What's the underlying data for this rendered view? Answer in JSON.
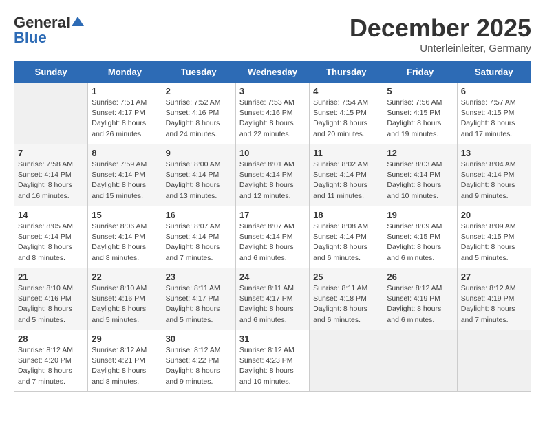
{
  "logo": {
    "general": "General",
    "blue": "Blue"
  },
  "header": {
    "month": "December 2025",
    "location": "Unterleinleiter, Germany"
  },
  "days_of_week": [
    "Sunday",
    "Monday",
    "Tuesday",
    "Wednesday",
    "Thursday",
    "Friday",
    "Saturday"
  ],
  "weeks": [
    [
      {
        "day": "",
        "info": ""
      },
      {
        "day": "1",
        "info": "Sunrise: 7:51 AM\nSunset: 4:17 PM\nDaylight: 8 hours\nand 26 minutes."
      },
      {
        "day": "2",
        "info": "Sunrise: 7:52 AM\nSunset: 4:16 PM\nDaylight: 8 hours\nand 24 minutes."
      },
      {
        "day": "3",
        "info": "Sunrise: 7:53 AM\nSunset: 4:16 PM\nDaylight: 8 hours\nand 22 minutes."
      },
      {
        "day": "4",
        "info": "Sunrise: 7:54 AM\nSunset: 4:15 PM\nDaylight: 8 hours\nand 20 minutes."
      },
      {
        "day": "5",
        "info": "Sunrise: 7:56 AM\nSunset: 4:15 PM\nDaylight: 8 hours\nand 19 minutes."
      },
      {
        "day": "6",
        "info": "Sunrise: 7:57 AM\nSunset: 4:15 PM\nDaylight: 8 hours\nand 17 minutes."
      }
    ],
    [
      {
        "day": "7",
        "info": "Sunrise: 7:58 AM\nSunset: 4:14 PM\nDaylight: 8 hours\nand 16 minutes."
      },
      {
        "day": "8",
        "info": "Sunrise: 7:59 AM\nSunset: 4:14 PM\nDaylight: 8 hours\nand 15 minutes."
      },
      {
        "day": "9",
        "info": "Sunrise: 8:00 AM\nSunset: 4:14 PM\nDaylight: 8 hours\nand 13 minutes."
      },
      {
        "day": "10",
        "info": "Sunrise: 8:01 AM\nSunset: 4:14 PM\nDaylight: 8 hours\nand 12 minutes."
      },
      {
        "day": "11",
        "info": "Sunrise: 8:02 AM\nSunset: 4:14 PM\nDaylight: 8 hours\nand 11 minutes."
      },
      {
        "day": "12",
        "info": "Sunrise: 8:03 AM\nSunset: 4:14 PM\nDaylight: 8 hours\nand 10 minutes."
      },
      {
        "day": "13",
        "info": "Sunrise: 8:04 AM\nSunset: 4:14 PM\nDaylight: 8 hours\nand 9 minutes."
      }
    ],
    [
      {
        "day": "14",
        "info": "Sunrise: 8:05 AM\nSunset: 4:14 PM\nDaylight: 8 hours\nand 8 minutes."
      },
      {
        "day": "15",
        "info": "Sunrise: 8:06 AM\nSunset: 4:14 PM\nDaylight: 8 hours\nand 8 minutes."
      },
      {
        "day": "16",
        "info": "Sunrise: 8:07 AM\nSunset: 4:14 PM\nDaylight: 8 hours\nand 7 minutes."
      },
      {
        "day": "17",
        "info": "Sunrise: 8:07 AM\nSunset: 4:14 PM\nDaylight: 8 hours\nand 6 minutes."
      },
      {
        "day": "18",
        "info": "Sunrise: 8:08 AM\nSunset: 4:14 PM\nDaylight: 8 hours\nand 6 minutes."
      },
      {
        "day": "19",
        "info": "Sunrise: 8:09 AM\nSunset: 4:15 PM\nDaylight: 8 hours\nand 6 minutes."
      },
      {
        "day": "20",
        "info": "Sunrise: 8:09 AM\nSunset: 4:15 PM\nDaylight: 8 hours\nand 5 minutes."
      }
    ],
    [
      {
        "day": "21",
        "info": "Sunrise: 8:10 AM\nSunset: 4:16 PM\nDaylight: 8 hours\nand 5 minutes."
      },
      {
        "day": "22",
        "info": "Sunrise: 8:10 AM\nSunset: 4:16 PM\nDaylight: 8 hours\nand 5 minutes."
      },
      {
        "day": "23",
        "info": "Sunrise: 8:11 AM\nSunset: 4:17 PM\nDaylight: 8 hours\nand 5 minutes."
      },
      {
        "day": "24",
        "info": "Sunrise: 8:11 AM\nSunset: 4:17 PM\nDaylight: 8 hours\nand 6 minutes."
      },
      {
        "day": "25",
        "info": "Sunrise: 8:11 AM\nSunset: 4:18 PM\nDaylight: 8 hours\nand 6 minutes."
      },
      {
        "day": "26",
        "info": "Sunrise: 8:12 AM\nSunset: 4:19 PM\nDaylight: 8 hours\nand 6 minutes."
      },
      {
        "day": "27",
        "info": "Sunrise: 8:12 AM\nSunset: 4:19 PM\nDaylight: 8 hours\nand 7 minutes."
      }
    ],
    [
      {
        "day": "28",
        "info": "Sunrise: 8:12 AM\nSunset: 4:20 PM\nDaylight: 8 hours\nand 7 minutes."
      },
      {
        "day": "29",
        "info": "Sunrise: 8:12 AM\nSunset: 4:21 PM\nDaylight: 8 hours\nand 8 minutes."
      },
      {
        "day": "30",
        "info": "Sunrise: 8:12 AM\nSunset: 4:22 PM\nDaylight: 8 hours\nand 9 minutes."
      },
      {
        "day": "31",
        "info": "Sunrise: 8:12 AM\nSunset: 4:23 PM\nDaylight: 8 hours\nand 10 minutes."
      },
      {
        "day": "",
        "info": ""
      },
      {
        "day": "",
        "info": ""
      },
      {
        "day": "",
        "info": ""
      }
    ]
  ]
}
